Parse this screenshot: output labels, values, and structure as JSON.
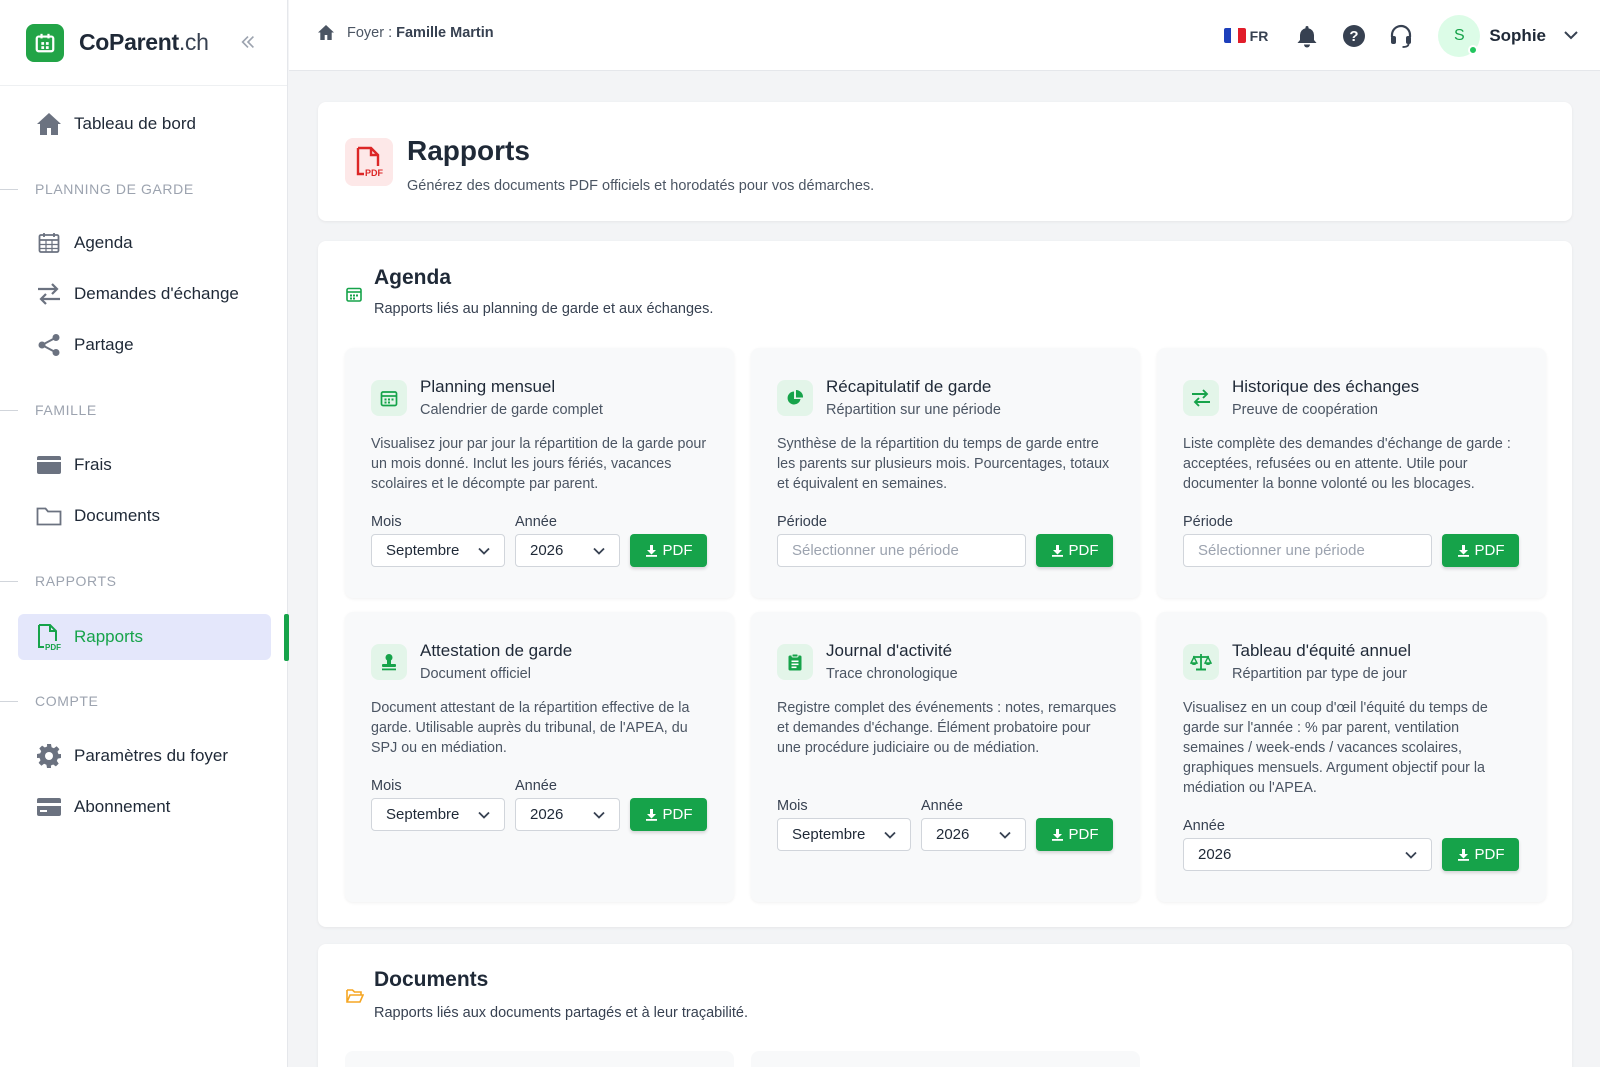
{
  "brand": {
    "name": "CoParent",
    "tld": ".ch"
  },
  "sidebar": {
    "dashboard": "Tableau de bord",
    "sections": {
      "planning": "PLANNING DE GARDE",
      "famille": "FAMILLE",
      "rapports": "RAPPORTS",
      "compte": "COMPTE"
    },
    "items": {
      "agenda": "Agenda",
      "echanges": "Demandes d'échange",
      "partage": "Partage",
      "frais": "Frais",
      "documents": "Documents",
      "rapports": "Rapports",
      "parametres": "Paramètres du foyer",
      "abonnement": "Abonnement"
    }
  },
  "topbar": {
    "breadcrumb_prefix": "Foyer :",
    "breadcrumb_value": "Famille Martin",
    "lang": "FR",
    "avatar_initial": "S",
    "user_name": "Sophie"
  },
  "header": {
    "title": "Rapports",
    "subtitle": "Générez des documents PDF officiels et horodatés pour vos démarches."
  },
  "agenda_section": {
    "title": "Agenda",
    "subtitle": "Rapports liés au planning de garde et aux échanges.",
    "cards": [
      {
        "title": "Planning mensuel",
        "subtitle": "Calendrier de garde complet",
        "description": "Visualisez jour par jour la répartition de la garde pour un mois donné. Inclut les jours fériés, vacances scolaires et le décompte par parent.",
        "month_label": "Mois",
        "month_value": "Septembre",
        "year_label": "Année",
        "year_value": "2026",
        "button": "PDF"
      },
      {
        "title": "Récapitulatif de garde",
        "subtitle": "Répartition sur une période",
        "description": "Synthèse de la répartition du temps de garde entre les parents sur plusieurs mois. Pourcentages, totaux et équivalent en semaines.",
        "period_label": "Période",
        "period_placeholder": "Sélectionner une période",
        "button": "PDF"
      },
      {
        "title": "Historique des échanges",
        "subtitle": "Preuve de coopération",
        "description": "Liste complète des demandes d'échange de garde : acceptées, refusées ou en attente. Utile pour documenter la bonne volonté ou les blocages.",
        "period_label": "Période",
        "period_placeholder": "Sélectionner une période",
        "button": "PDF"
      },
      {
        "title": "Attestation de garde",
        "subtitle": "Document officiel",
        "description": "Document attestant de la répartition effective de la garde. Utilisable auprès du tribunal, de l'APEA, du SPJ ou en médiation.",
        "month_label": "Mois",
        "month_value": "Septembre",
        "year_label": "Année",
        "year_value": "2026",
        "button": "PDF"
      },
      {
        "title": "Journal d'activité",
        "subtitle": "Trace chronologique",
        "description": "Registre complet des événements : notes, remarques et demandes d'échange. Élément probatoire pour une procédure judiciaire ou de médiation.",
        "month_label": "Mois",
        "month_value": "Septembre",
        "year_label": "Année",
        "year_value": "2026",
        "button": "PDF"
      },
      {
        "title": "Tableau d'équité annuel",
        "subtitle": "Répartition par type de jour",
        "description": "Visualisez en un coup d'œil l'équité du temps de garde sur l'année : % par parent, ventilation semaines / week-ends / vacances scolaires, graphiques mensuels. Argument objectif pour la médiation ou l'APEA.",
        "year_label": "Année",
        "year_value": "2026",
        "button": "PDF"
      }
    ]
  },
  "documents_section": {
    "title": "Documents",
    "subtitle": "Rapports liés aux documents partagés et à leur traçabilité."
  },
  "colors": {
    "accent": "#16a34a",
    "active_bg": "#e4e7fb",
    "pdf_red": "#dc2626",
    "folder_yellow": "#f5a623"
  },
  "icons": {
    "brand": "calendar-logo-icon",
    "collapse": "double-chevron-left-icon",
    "home": "home-icon",
    "bell": "bell-icon",
    "help": "question-circle-icon",
    "support": "headset-icon"
  }
}
